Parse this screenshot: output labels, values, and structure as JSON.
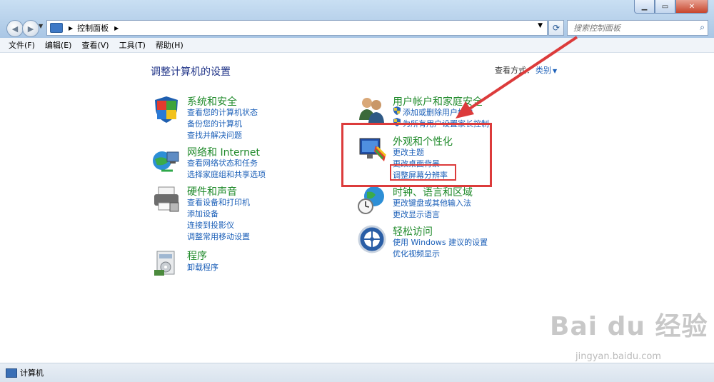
{
  "window": {
    "breadcrumb": "控制面板",
    "search_placeholder": "搜索控制面板"
  },
  "menu": [
    "文件(F)",
    "编辑(E)",
    "查看(V)",
    "工具(T)",
    "帮助(H)"
  ],
  "page": {
    "title": "调整计算机的设置",
    "view_by_label": "查看方式：",
    "view_by_value": "类别"
  },
  "categories": [
    {
      "title": "系统和安全",
      "icon": "shield-icon",
      "links": [
        "查看您的计算机状态",
        "备份您的计算机",
        "查找并解决问题"
      ]
    },
    {
      "title": "网络和 Internet",
      "icon": "network-icon",
      "links": [
        "查看网络状态和任务",
        "选择家庭组和共享选项"
      ]
    },
    {
      "title": "硬件和声音",
      "icon": "printer-icon",
      "links": [
        "查看设备和打印机",
        "添加设备",
        "连接到投影仪",
        "调整常用移动设置"
      ]
    },
    {
      "title": "程序",
      "icon": "programs-icon",
      "links": [
        "卸载程序"
      ]
    },
    {
      "title": "用户帐户和家庭安全",
      "icon": "users-icon",
      "links": [
        "添加或删除用户帐户",
        "为所有用户设置家长控制"
      ]
    },
    {
      "title": "外观和个性化",
      "icon": "display-icon",
      "links": [
        "更改主题",
        "更改桌面背景",
        "调整屏幕分辨率"
      ]
    },
    {
      "title": "时钟、语言和区域",
      "icon": "globe-clock-icon",
      "links": [
        "更改键盘或其他输入法",
        "更改显示语言"
      ]
    },
    {
      "title": "轻松访问",
      "icon": "accessibility-icon",
      "links": [
        "使用 Windows 建议的设置",
        "优化视频显示"
      ]
    }
  ],
  "status_bar": "计算机",
  "watermark": {
    "brand": "Bai du 经验",
    "url": "jingyan.baidu.com"
  },
  "colors": {
    "link": "#1b5fb8",
    "category_title": "#1f8a2a",
    "annotation": "#dc3b3b"
  }
}
